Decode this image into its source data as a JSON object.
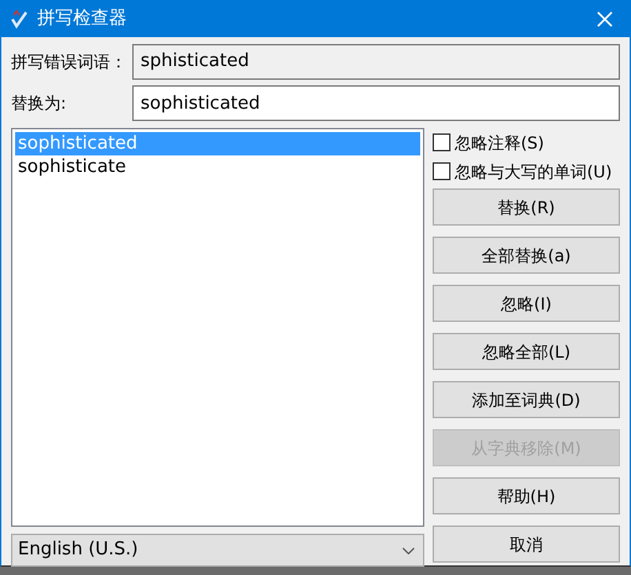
{
  "window": {
    "title": "拼写检查器"
  },
  "misspelled": {
    "label": "拼写错误词语：",
    "value": "sphisticated"
  },
  "replace_with": {
    "label": "替换为:",
    "value": "sophisticated"
  },
  "suggestions": [
    {
      "text": "sophisticated",
      "selected": true
    },
    {
      "text": "sophisticate",
      "selected": false
    }
  ],
  "options": [
    {
      "label": "忽略注释(S)",
      "checked": false
    },
    {
      "label": "忽略与大写的单词(U)",
      "checked": false
    }
  ],
  "buttons": [
    {
      "label": "替换(R)",
      "disabled": false
    },
    {
      "label": "全部替换(a)",
      "disabled": false
    },
    {
      "label": "忽略(I)",
      "disabled": false
    },
    {
      "label": "忽略全部(L)",
      "disabled": false
    },
    {
      "label": "添加至词典(D)",
      "disabled": false
    },
    {
      "label": "从字典移除(M)",
      "disabled": true
    },
    {
      "label": "帮助(H)",
      "disabled": false
    },
    {
      "label": "取消",
      "disabled": false
    }
  ],
  "language": {
    "value": "English (U.S.)"
  }
}
